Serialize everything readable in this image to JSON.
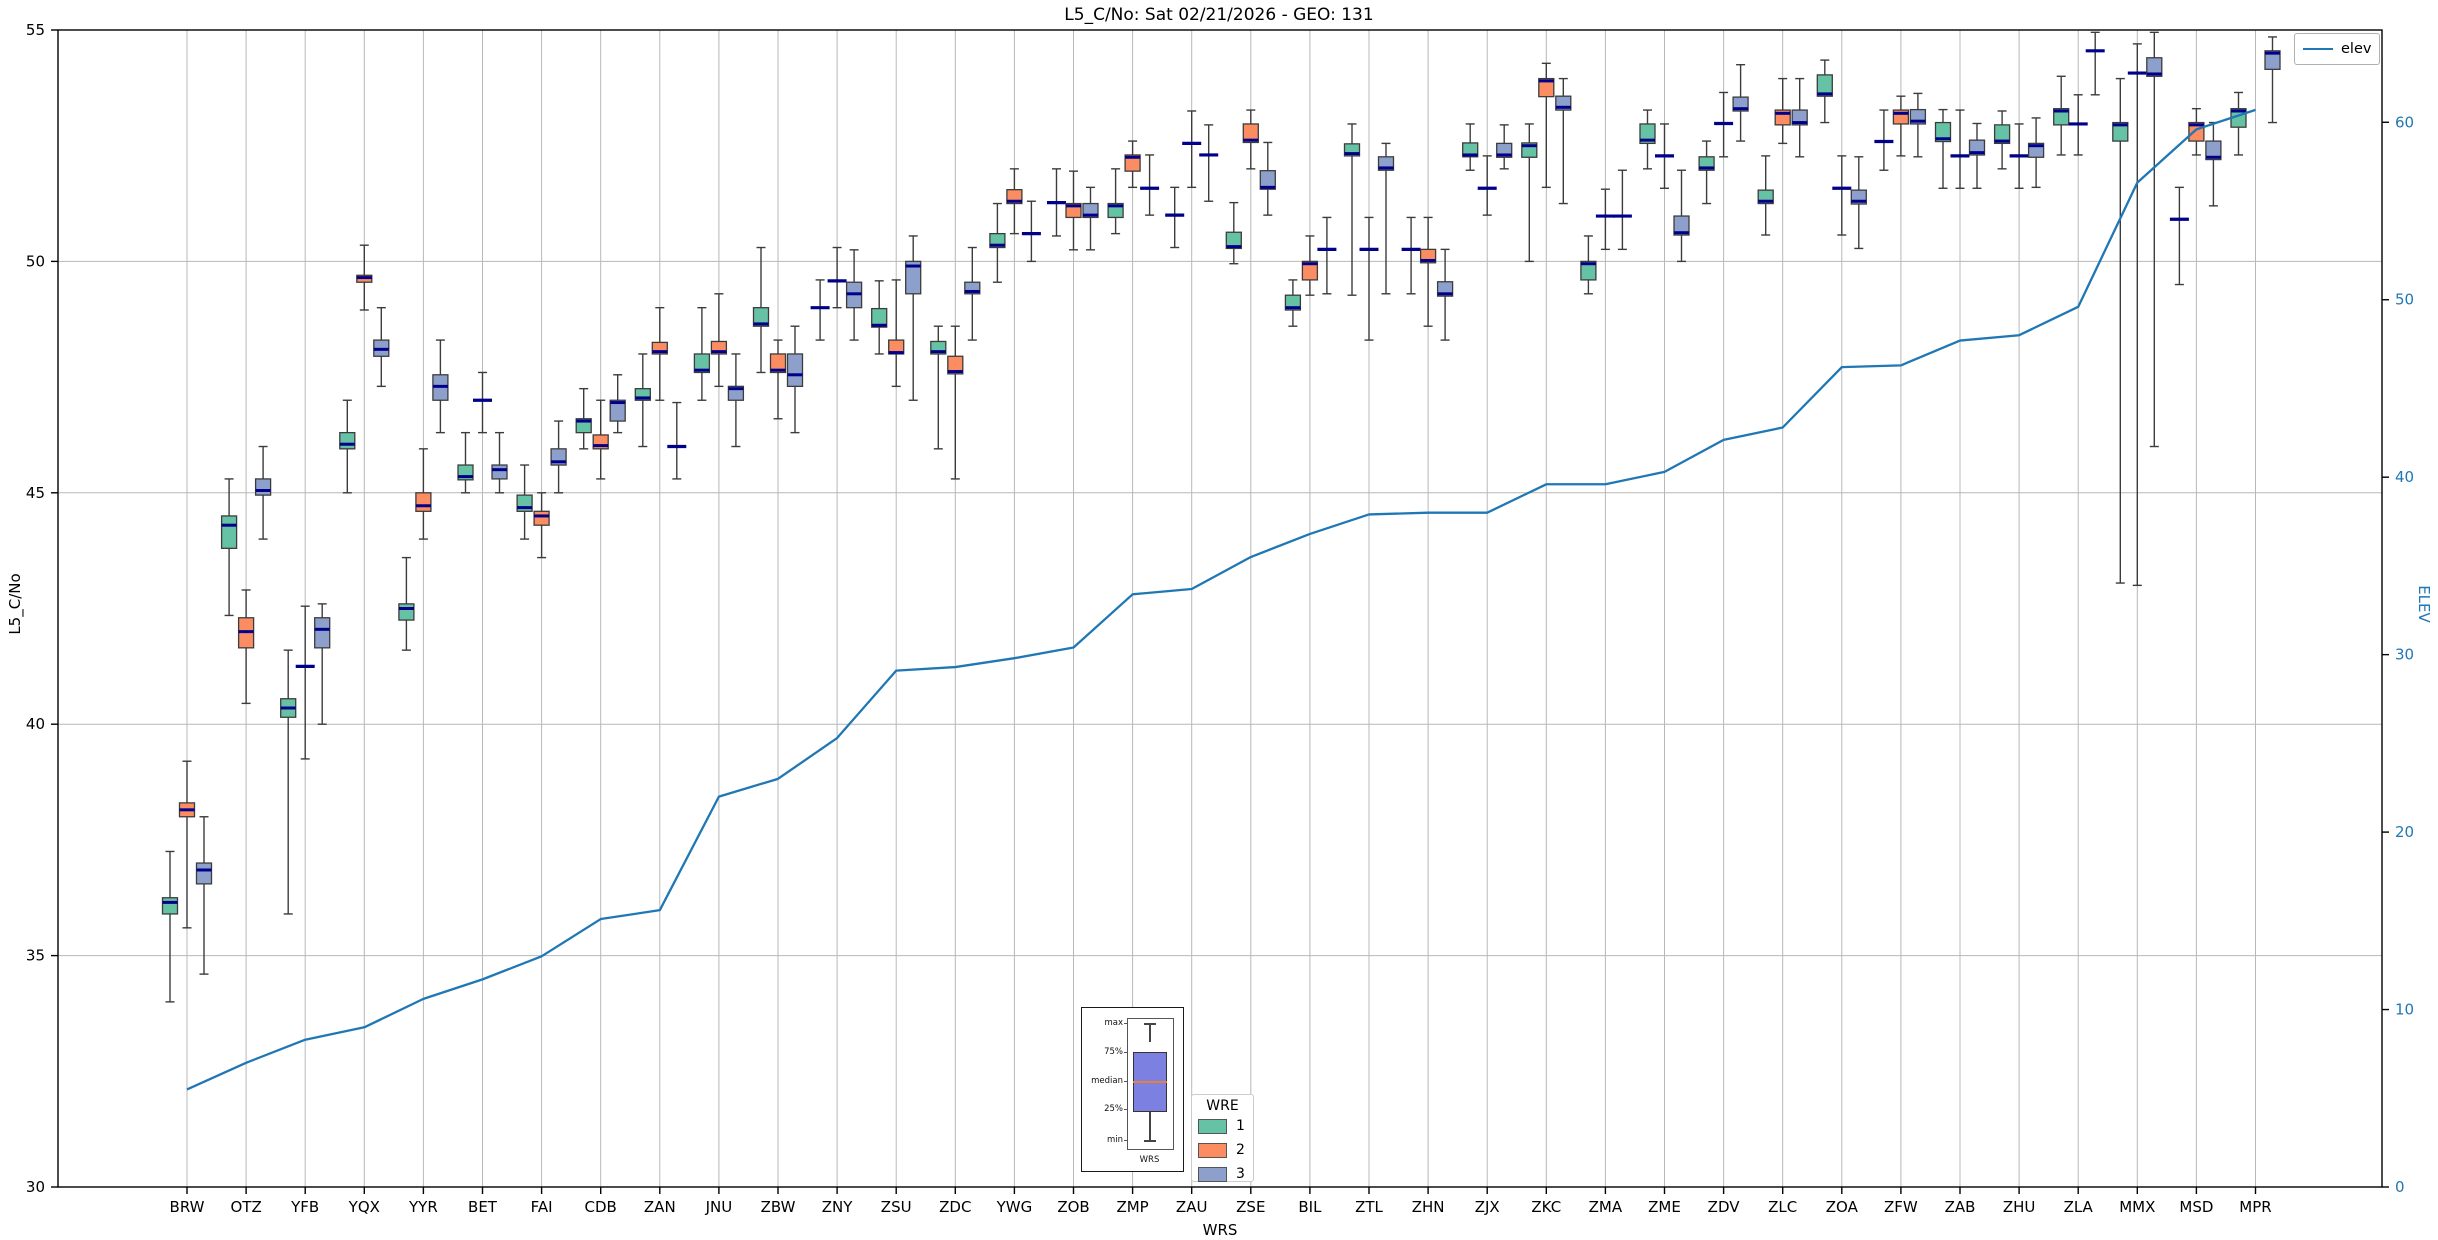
{
  "title": "L5_C/No: Sat 02/21/2026 - GEO: 131",
  "axes": {
    "left_label": "L5_C/No",
    "right_label": "ELEV",
    "x_label": "WRS",
    "left_ticks": [
      30,
      35,
      40,
      45,
      50,
      55
    ],
    "right_ticks": [
      0,
      10,
      20,
      30,
      40,
      50,
      60
    ]
  },
  "legend": {
    "elev_label": "elev"
  },
  "wre_legend": {
    "title": "WRE",
    "entries": [
      {
        "label": "1",
        "color": "#66c2a5"
      },
      {
        "label": "2",
        "color": "#fc8d62"
      },
      {
        "label": "3",
        "color": "#8da0cb"
      }
    ]
  },
  "inset": {
    "labels": [
      "max",
      "75%",
      "median",
      "25%",
      "min"
    ],
    "xlabel": "WRS",
    "box_color": "#7c80e0",
    "median_color": "#e8803c"
  },
  "colors": {
    "grid": "#b8b8b8",
    "spine": "#000000",
    "box_edge": "#3c3c3c",
    "whisker": "#3c3c3c",
    "median": "#00008b",
    "elev_line": "#1f77b4",
    "right_axis_text": "#1f77b4"
  },
  "chart_data": {
    "type": "boxplot+line",
    "title": "L5_C/No: Sat 02/21/2026 - GEO: 131",
    "xlabel": "WRS",
    "ylabel_left": "L5_C/No",
    "ylabel_right": "ELEV",
    "ylim_left": [
      30,
      55
    ],
    "ylim_right": [
      0,
      65.2
    ],
    "grid": true,
    "categories": [
      "BRW",
      "OTZ",
      "YFB",
      "YQX",
      "YYR",
      "BET",
      "FAI",
      "CDB",
      "ZAN",
      "JNU",
      "ZBW",
      "ZNY",
      "ZSU",
      "ZDC",
      "YWG",
      "ZOB",
      "ZMP",
      "ZAU",
      "ZSE",
      "BIL",
      "ZTL",
      "ZHN",
      "ZJX",
      "ZKC",
      "ZMA",
      "ZME",
      "ZDV",
      "ZLC",
      "ZOA",
      "ZFW",
      "ZAB",
      "ZHU",
      "ZLA",
      "MMX",
      "MSD",
      "MPR"
    ],
    "series": [
      {
        "name": "1",
        "color": "#66c2a5",
        "boxes": [
          [
            34.0,
            35.9,
            36.15,
            36.25,
            37.25
          ],
          [
            42.35,
            43.8,
            44.3,
            44.5,
            45.3
          ],
          [
            35.9,
            40.15,
            40.35,
            40.55,
            41.6
          ],
          [
            45.0,
            45.95,
            46.05,
            46.3,
            47.0
          ],
          [
            41.6,
            42.25,
            42.5,
            42.6,
            43.6
          ],
          [
            45.0,
            45.28,
            45.35,
            45.6,
            46.3
          ],
          [
            44.0,
            44.6,
            44.68,
            44.95,
            45.6
          ],
          [
            45.95,
            46.3,
            46.55,
            46.6,
            47.25
          ],
          [
            46.0,
            47.0,
            47.05,
            47.25,
            48.0
          ],
          [
            47.0,
            47.6,
            47.65,
            48.0,
            49.0
          ],
          [
            47.6,
            48.6,
            48.65,
            49.0,
            50.3
          ],
          [
            48.3,
            49.0,
            49.0,
            49.0,
            49.6
          ],
          [
            48.0,
            48.58,
            48.62,
            48.98,
            49.58
          ],
          [
            45.95,
            48.0,
            48.05,
            48.27,
            48.6
          ],
          [
            49.55,
            50.3,
            50.35,
            50.6,
            51.25
          ],
          [
            50.55,
            51.27,
            51.27,
            51.27,
            52.0
          ],
          [
            50.6,
            50.95,
            51.2,
            51.25,
            52.0
          ],
          [
            50.3,
            51.0,
            51.0,
            51.0,
            51.6
          ],
          [
            49.95,
            50.28,
            50.32,
            50.63,
            51.27
          ],
          [
            48.6,
            48.95,
            49.0,
            49.27,
            49.6
          ],
          [
            49.27,
            52.28,
            52.33,
            52.54,
            52.97
          ],
          [
            49.3,
            50.26,
            50.26,
            50.26,
            50.95
          ],
          [
            51.97,
            52.26,
            52.3,
            52.56,
            52.97
          ],
          [
            50.0,
            52.25,
            52.5,
            52.56,
            52.97
          ],
          [
            49.3,
            49.6,
            49.95,
            50.0,
            50.55
          ],
          [
            52.0,
            52.55,
            52.62,
            52.97,
            53.27
          ],
          [
            51.25,
            51.97,
            52.02,
            52.26,
            52.6
          ],
          [
            50.57,
            51.25,
            51.3,
            51.54,
            52.28
          ],
          [
            53.0,
            53.57,
            53.62,
            54.03,
            54.35
          ],
          [
            51.97,
            52.59,
            52.59,
            52.59,
            53.27
          ],
          [
            51.58,
            52.59,
            52.65,
            53.0,
            53.28
          ],
          [
            52.0,
            52.55,
            52.6,
            52.95,
            53.25
          ],
          [
            52.3,
            52.95,
            53.25,
            53.3,
            54.0
          ],
          [
            43.05,
            52.6,
            52.95,
            53.0,
            53.95
          ],
          [
            49.5,
            50.91,
            50.91,
            50.91,
            51.6
          ],
          [
            52.3,
            52.9,
            53.25,
            53.3,
            53.65
          ]
        ]
      },
      {
        "name": "2",
        "color": "#fc8d62",
        "boxes": [
          [
            35.6,
            38.0,
            38.15,
            38.3,
            39.2
          ],
          [
            40.45,
            41.65,
            42.0,
            42.3,
            42.9
          ],
          [
            39.25,
            41.25,
            41.25,
            41.25,
            42.55
          ],
          [
            48.95,
            49.55,
            49.65,
            49.7,
            50.35
          ],
          [
            44.0,
            44.6,
            44.72,
            45.0,
            45.95
          ],
          [
            46.3,
            47.0,
            47.0,
            47.0,
            47.6
          ],
          [
            43.6,
            44.3,
            44.5,
            44.6,
            45.0
          ],
          [
            45.3,
            45.95,
            46.02,
            46.25,
            47.0
          ],
          [
            47.0,
            48.0,
            48.05,
            48.25,
            49.0
          ],
          [
            47.3,
            48.0,
            48.05,
            48.27,
            49.3
          ],
          [
            46.6,
            47.6,
            47.65,
            48.0,
            48.3
          ],
          [
            49.0,
            49.58,
            49.58,
            49.58,
            50.3
          ],
          [
            47.3,
            48.0,
            48.03,
            48.3,
            49.6
          ],
          [
            45.3,
            47.57,
            47.62,
            47.95,
            48.6
          ],
          [
            50.6,
            51.25,
            51.3,
            51.55,
            52.0
          ],
          [
            50.25,
            50.95,
            51.2,
            51.25,
            51.95
          ],
          [
            51.6,
            51.95,
            52.25,
            52.3,
            52.6
          ],
          [
            51.6,
            52.55,
            52.55,
            52.55,
            53.25
          ],
          [
            52.0,
            52.57,
            52.62,
            52.97,
            53.27
          ],
          [
            49.27,
            49.6,
            49.95,
            50.0,
            50.55
          ],
          [
            48.3,
            50.26,
            50.26,
            50.26,
            50.95
          ],
          [
            48.6,
            49.97,
            50.02,
            50.26,
            50.95
          ],
          [
            51.0,
            51.58,
            51.58,
            51.58,
            52.28
          ],
          [
            51.6,
            53.56,
            53.9,
            53.95,
            54.28
          ],
          [
            50.26,
            50.98,
            50.98,
            50.98,
            51.56
          ],
          [
            51.58,
            52.28,
            52.28,
            52.28,
            52.97
          ],
          [
            52.26,
            52.98,
            52.98,
            52.98,
            53.65
          ],
          [
            52.55,
            52.95,
            53.2,
            53.27,
            53.95
          ],
          [
            50.57,
            51.58,
            51.58,
            51.58,
            52.28
          ],
          [
            52.28,
            52.97,
            53.2,
            53.27,
            53.57
          ],
          [
            51.58,
            52.28,
            52.28,
            52.28,
            53.27
          ],
          [
            51.58,
            52.28,
            52.28,
            52.28,
            52.97
          ],
          [
            52.3,
            52.97,
            52.97,
            52.97,
            53.6
          ],
          [
            43.0,
            54.07,
            54.07,
            54.07,
            54.7
          ],
          [
            52.3,
            52.6,
            52.95,
            53.0,
            53.3
          ],
          null
        ]
      },
      {
        "name": "3",
        "color": "#8da0cb",
        "boxes": [
          [
            34.6,
            36.55,
            36.85,
            37.0,
            38.0
          ],
          [
            44.0,
            44.95,
            45.05,
            45.3,
            46.0
          ],
          [
            40.0,
            41.65,
            42.05,
            42.3,
            42.6
          ],
          [
            47.3,
            47.95,
            48.1,
            48.3,
            49.0
          ],
          [
            46.3,
            47.0,
            47.3,
            47.55,
            48.3
          ],
          [
            45.0,
            45.3,
            45.5,
            45.6,
            46.3
          ],
          [
            45.0,
            45.6,
            45.67,
            45.95,
            46.55
          ],
          [
            46.3,
            46.55,
            46.95,
            47.0,
            47.55
          ],
          [
            45.3,
            46.0,
            46.0,
            46.0,
            46.95
          ],
          [
            46.0,
            47.0,
            47.25,
            47.3,
            48.0
          ],
          [
            46.3,
            47.3,
            47.55,
            48.0,
            48.6
          ],
          [
            48.3,
            49.0,
            49.3,
            49.55,
            50.25
          ],
          [
            47.0,
            49.3,
            49.9,
            50.0,
            50.55
          ],
          [
            48.3,
            49.3,
            49.35,
            49.55,
            50.3
          ],
          [
            50.0,
            50.6,
            50.6,
            50.6,
            51.3
          ],
          [
            50.25,
            50.95,
            51.0,
            51.25,
            51.6
          ],
          [
            51.0,
            51.58,
            51.58,
            51.58,
            52.3
          ],
          [
            51.3,
            52.3,
            52.3,
            52.3,
            52.95
          ],
          [
            51.0,
            51.56,
            51.6,
            51.96,
            52.57
          ],
          [
            49.3,
            50.26,
            50.26,
            50.26,
            50.95
          ],
          [
            49.3,
            51.97,
            52.02,
            52.26,
            52.55
          ],
          [
            48.3,
            49.25,
            49.3,
            49.56,
            50.26
          ],
          [
            52.0,
            52.25,
            52.3,
            52.55,
            52.95
          ],
          [
            51.25,
            53.27,
            53.33,
            53.57,
            53.95
          ],
          [
            50.26,
            50.98,
            50.98,
            50.98,
            51.97
          ],
          [
            50.0,
            50.57,
            50.62,
            50.98,
            51.97
          ],
          [
            52.6,
            53.25,
            53.3,
            53.55,
            54.25
          ],
          [
            52.26,
            52.95,
            53.0,
            53.27,
            53.95
          ],
          [
            50.28,
            51.24,
            51.3,
            51.54,
            52.26
          ],
          [
            52.26,
            52.97,
            53.03,
            53.28,
            53.63
          ],
          [
            51.58,
            52.3,
            52.35,
            52.62,
            52.98
          ],
          [
            51.6,
            52.25,
            52.5,
            52.55,
            53.1
          ],
          [
            53.6,
            54.55,
            54.55,
            54.55,
            54.95
          ],
          [
            46.0,
            54.0,
            54.05,
            54.4,
            54.95
          ],
          [
            51.2,
            52.2,
            52.25,
            52.6,
            53.0
          ],
          [
            53.0,
            54.15,
            54.5,
            54.55,
            54.85
          ]
        ]
      }
    ],
    "line": {
      "name": "elev",
      "color": "#1f77b4",
      "axis": "right",
      "values": [
        5.5,
        7.0,
        8.3,
        9.0,
        10.6,
        11.7,
        13.0,
        15.1,
        15.6,
        22.0,
        23.0,
        25.3,
        29.1,
        29.3,
        29.8,
        30.4,
        33.4,
        33.7,
        35.5,
        36.8,
        37.9,
        38.0,
        38.0,
        39.6,
        39.6,
        40.3,
        42.1,
        42.8,
        46.2,
        46.3,
        47.7,
        48.0,
        49.6,
        56.6,
        59.6,
        60.7
      ]
    }
  }
}
